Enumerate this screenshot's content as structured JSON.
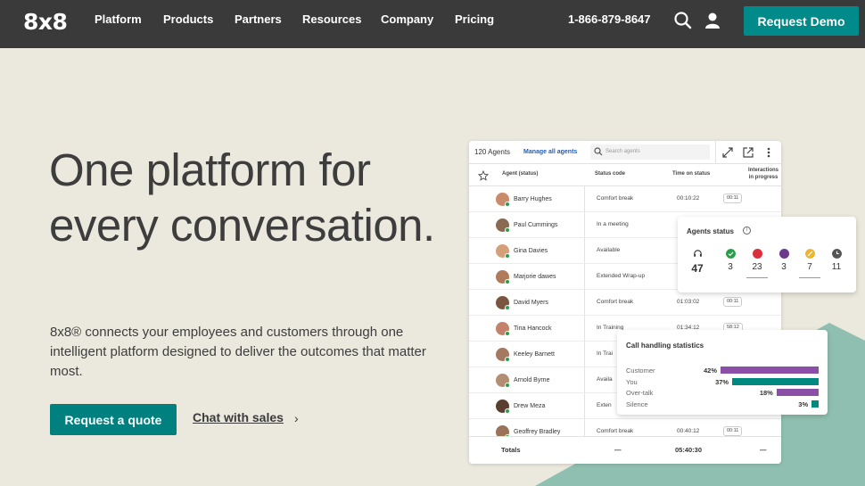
{
  "nav": {
    "logo": "8x8",
    "items": [
      "Platform",
      "Products",
      "Partners",
      "Resources",
      "Company",
      "Pricing"
    ],
    "phone": "1-866-879-8647",
    "search_icon": "search-icon",
    "user_icon": "user-icon",
    "cta": "Request Demo"
  },
  "hero": {
    "title": "One platform for every conversation.",
    "description": "8x8® connects your employees and customers through one intelligent platform designed to deliver the outcomes that matter most.",
    "primary_cta": "Request a quote",
    "secondary_cta": "Chat with sales"
  },
  "colors": {
    "nav_bg": "#3a3a3a",
    "teal": "#008a8a",
    "page_bg": "#ebe8dd",
    "purple": "#8b4fa8",
    "green": "#2a9d4a",
    "red": "#d9303b",
    "yellow": "#f0b429"
  },
  "dashboard": {
    "agents_count": "120 Agents",
    "manage_link": "Manage all agents",
    "search_placeholder": "Search agents",
    "columns": {
      "agent": "Agent (status)",
      "status_code": "Status code",
      "time": "Time on status",
      "interactions": "Interactions in progress"
    },
    "rows": [
      {
        "name": "Barry Hughes",
        "status": "Comfort break",
        "time": "00:10:22",
        "pill": "00:11"
      },
      {
        "name": "Paul Cummings",
        "status": "In a meeting",
        "time": "",
        "pill": ""
      },
      {
        "name": "Gina Davies",
        "status": "Available",
        "time": "",
        "pill": ""
      },
      {
        "name": "Marjorie dawes",
        "status": "Extended Wrap-up",
        "time": "",
        "pill": ""
      },
      {
        "name": "David Myers",
        "status": "Comfort break",
        "time": "01:03:02",
        "pill": "00:11"
      },
      {
        "name": "Tina Hancock",
        "status": "In Training",
        "time": "01:34:12",
        "pill": "58:12"
      },
      {
        "name": "Keeley Barnett",
        "status": "In Trai",
        "time": "",
        "pill": ""
      },
      {
        "name": "Arnold Byrne",
        "status": "Availa",
        "time": "",
        "pill": ""
      },
      {
        "name": "Drew Meza",
        "status": "Exten",
        "time": "",
        "pill": ""
      },
      {
        "name": "Geoffrey Bradley",
        "status": "Comfort break",
        "time": "00:40:12",
        "pill": "00:11"
      }
    ],
    "totals": {
      "label": "Totals",
      "dash1": "—",
      "time": "05:40:30",
      "dash2": "—"
    }
  },
  "agents_status": {
    "title": "Agents status",
    "total": "47",
    "counts": [
      "3",
      "23",
      "3",
      "7",
      "11"
    ]
  },
  "call_stats": {
    "title": "Call handling statistics",
    "rows": [
      {
        "label": "Customer",
        "pct": "42%",
        "value": 42
      },
      {
        "label": "You",
        "pct": "37%",
        "value": 37
      },
      {
        "label": "Over-talk",
        "pct": "18%",
        "value": 18
      },
      {
        "label": "Silence",
        "pct": "3%",
        "value": 3
      }
    ]
  }
}
